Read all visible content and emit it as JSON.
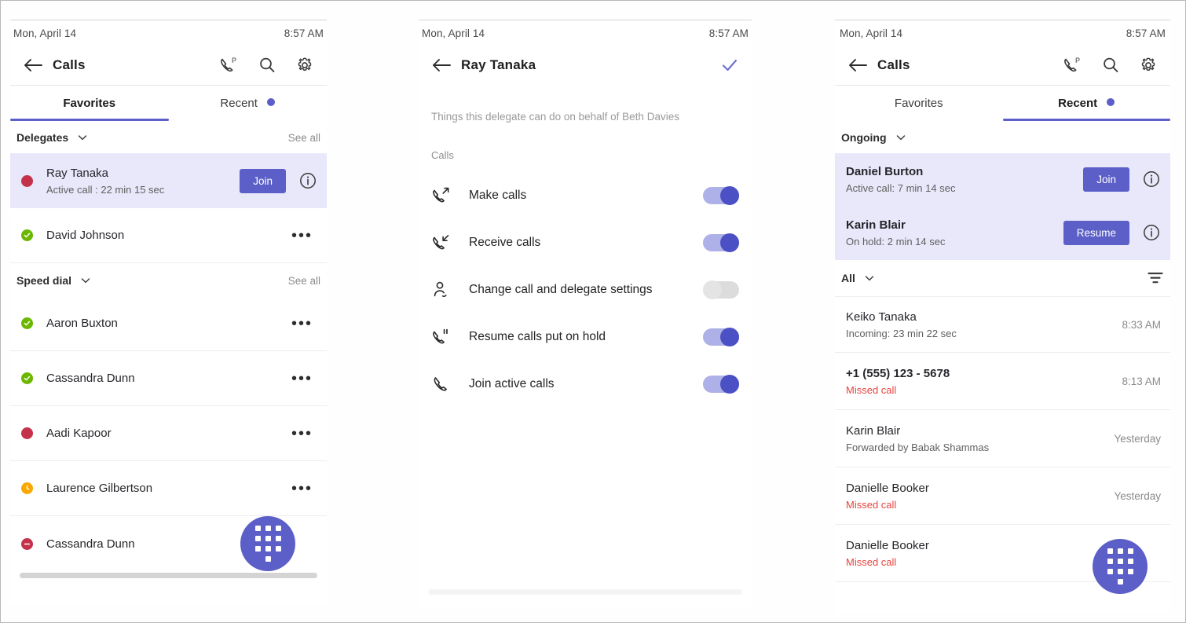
{
  "common": {
    "status_date": "Mon, April 14",
    "status_time": "8:57 AM",
    "app_title": "Calls",
    "icons": {
      "back": "arrow-left-icon",
      "parked_calls": "phone-parked-icon",
      "search": "search-icon",
      "settings": "gear-icon",
      "dialpad": "dialpad-icon",
      "info": "info-icon",
      "filter": "filter-icon",
      "chevron": "chevron-down-icon",
      "more": "more-options-icon",
      "confirm": "checkmark-icon"
    },
    "colors": {
      "accent": "#5b5fc7",
      "accent_soft": "#aeb0e8",
      "highlight_row": "#e8e8fa",
      "available": "#6bb700",
      "busy": "#c4314b",
      "away": "#f8a800",
      "dnd": "#c4314b",
      "missed": "#e8443f"
    }
  },
  "panel1": {
    "status_date": "Mon, April 14",
    "status_time": "8:57 AM",
    "title": "Calls",
    "tabs": [
      {
        "label": "Favorites",
        "active": true,
        "dot": false
      },
      {
        "label": "Recent",
        "active": false,
        "dot": true
      }
    ],
    "sections": [
      {
        "label": "Delegates",
        "action": "See all"
      },
      {
        "label": "Speed dial",
        "action": "See all"
      }
    ],
    "delegates": [
      {
        "name": "Ray Tanaka",
        "sub": "Active call : 22 min 15 sec",
        "presence": "busy",
        "button": "Join",
        "highlight": true
      },
      {
        "name": "David Johnson",
        "sub": "",
        "presence": "available",
        "button": "",
        "highlight": false
      }
    ],
    "speed_dial": [
      {
        "name": "Aaron Buxton",
        "presence": "available"
      },
      {
        "name": "Cassandra Dunn",
        "presence": "available"
      },
      {
        "name": "Aadi Kapoor",
        "presence": "busy"
      },
      {
        "name": "Laurence Gilbertson",
        "presence": "away"
      },
      {
        "name": "Cassandra Dunn",
        "presence": "dnd"
      }
    ]
  },
  "panel2": {
    "status_date": "Mon, April 14",
    "status_time": "8:57 AM",
    "title": "Ray Tanaka",
    "description": "Things this delegate can do on behalf of Beth Davies",
    "group_label": "Calls",
    "permissions": [
      {
        "label": "Make calls",
        "icon": "call-outgoing-icon",
        "on": true
      },
      {
        "label": "Receive calls",
        "icon": "call-incoming-icon",
        "on": true
      },
      {
        "label": "Change call and delegate settings",
        "icon": "person-settings-icon",
        "on": false
      },
      {
        "label": "Resume calls put on hold",
        "icon": "call-hold-icon",
        "on": true
      },
      {
        "label": "Join active calls",
        "icon": "call-icon",
        "on": true
      }
    ]
  },
  "panel3": {
    "status_date": "Mon, April 14",
    "status_time": "8:57 AM",
    "title": "Calls",
    "tabs": [
      {
        "label": "Favorites",
        "active": false,
        "dot": false
      },
      {
        "label": "Recent",
        "active": true,
        "dot": true
      }
    ],
    "ongoing_header": "Ongoing",
    "ongoing": [
      {
        "name": "Daniel Burton",
        "sub": "Active call: 7 min 14 sec",
        "button": "Join"
      },
      {
        "name": "Karin Blair",
        "sub": "On hold: 2 min 14 sec",
        "button": "Resume"
      }
    ],
    "filter_label": "All",
    "recent": [
      {
        "name": "Keiko Tanaka",
        "sub": "Incoming: 23 min 22 sec",
        "missed": false,
        "time": "8:33 AM"
      },
      {
        "name": "+1 (555) 123 - 5678",
        "sub": "Missed call",
        "missed": true,
        "time": "8:13 AM"
      },
      {
        "name": "Karin Blair",
        "sub": "Forwarded by Babak Shammas",
        "missed": false,
        "time": "Yesterday"
      },
      {
        "name": "Danielle Booker",
        "sub": "Missed call",
        "missed": true,
        "time": "Yesterday"
      },
      {
        "name": "Danielle Booker",
        "sub": "Missed call",
        "missed": true,
        "time": ""
      }
    ]
  }
}
